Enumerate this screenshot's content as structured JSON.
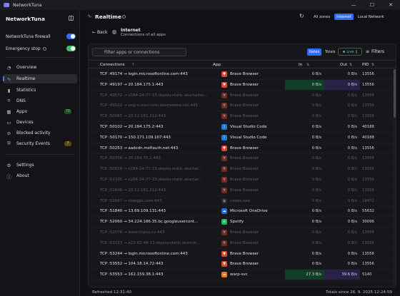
{
  "window": {
    "title": "NetworkTuna",
    "minimize": "—",
    "maximize": "☐",
    "close": "✕"
  },
  "sidebar": {
    "brand": "NetworkTuna",
    "firewall_label": "NetworkTuna firewall",
    "firewall_on": true,
    "emergency_label": "Emergency stop",
    "emergency_on": true,
    "items": [
      {
        "label": "Overview",
        "icon": "◔"
      },
      {
        "label": "Realtime",
        "icon": "∿"
      },
      {
        "label": "Statistics",
        "icon": "▮"
      },
      {
        "label": "DNS",
        "icon": "⌗"
      },
      {
        "label": "Apps",
        "icon": "▦",
        "badge": "78"
      },
      {
        "label": "Devices",
        "icon": "▭"
      },
      {
        "label": "Blocked activity",
        "icon": "⊘"
      },
      {
        "label": "Security Events",
        "icon": "⛨",
        "badge": "7"
      }
    ],
    "bottom_items": [
      {
        "label": "Settings",
        "icon": "⚙"
      },
      {
        "label": "About",
        "icon": "ⓘ"
      }
    ],
    "colors": {
      "toggle_on": "#2f6cff",
      "toggle_green": "#3fc06a",
      "apps_badge_bg": "#1f4a2c",
      "apps_badge_fg": "#4fd07a",
      "security_badge_bg": "#5a4a14",
      "security_badge_fg": "#f2c744"
    }
  },
  "header": {
    "title": "Realtime",
    "zones": [
      "All zones",
      "Internet",
      "Local Network"
    ],
    "selected_zone": "Internet"
  },
  "breadcrumb": {
    "back_label": "Back",
    "title": "Internet",
    "subtitle": "Connections of all apps"
  },
  "toolbar": {
    "search_placeholder": "Filter apps or connections",
    "modes": [
      "Rates",
      "Totals"
    ],
    "selected_mode": "Rates",
    "live_label": "Live",
    "filters_label": "Filters"
  },
  "table": {
    "columns": {
      "connections": "Connections",
      "app": "App",
      "in": "In",
      "out": "Out",
      "pid": "PID"
    },
    "rows": [
      {
        "conn": "TCP :49174 → login.microsoftonline.com:443",
        "app": "Brave Browser",
        "icon": "brave",
        "in": "0 B/s",
        "out": "0 B/s",
        "pid": "13556",
        "dim": false
      },
      {
        "conn": "TCP :49197 → 20.184.175.1:443",
        "app": "Brave Browser",
        "icon": "brave",
        "in": "0 B/s",
        "out": "0 B/s",
        "pid": "13556",
        "dim": false,
        "hi_in": true,
        "hi_out": true
      },
      {
        "conn": "TCP :49572 → s184-24-77-33.deploy.static.akamaitec...",
        "app": "Brave Browser",
        "icon": "brave",
        "in": "0 B/s",
        "out": "0 B/s",
        "pid": "13556",
        "dim": true
      },
      {
        "conn": "TCP :49522 → eng-s-msn-com.akamaized.net:443",
        "app": "Brave Browser",
        "icon": "brave",
        "in": "0 B/s",
        "out": "0 B/s",
        "pid": "13556",
        "dim": true
      },
      {
        "conn": "TCP :50065 → 23.12.161.212:443",
        "app": "Brave Browser",
        "icon": "brave",
        "in": "0 B/s",
        "out": "0 B/s",
        "pid": "13556",
        "dim": true
      },
      {
        "conn": "TCP :50102 → 20.184.175.2:443",
        "app": "Visual Studio Code",
        "icon": "vscode",
        "in": "0 B/s",
        "out": "0 B/s",
        "pid": "40188",
        "dim": false
      },
      {
        "conn": "TCP :50170 → 150.171.109.107:443",
        "app": "Visual Studio Code",
        "icon": "vscode",
        "in": "0 B/s",
        "out": "0 B/s",
        "pid": "40188",
        "dim": false
      },
      {
        "conn": "TCP :50253 → aadcdn.msftauth.net:443",
        "app": "Brave Browser",
        "icon": "brave",
        "in": "0 B/s",
        "out": "0 B/s",
        "pid": "13556",
        "dim": false
      },
      {
        "conn": "TCP :50756 → 35.184.75.1:443",
        "app": "Brave Browser",
        "icon": "brave",
        "in": "0 B/s",
        "out": "0 B/s",
        "pid": "13556",
        "dim": true
      },
      {
        "conn": "TCP :50828 → s184-24-77-33.deploy.static.akamai...",
        "app": "Brave Browser",
        "icon": "brave",
        "in": "0 B/s",
        "out": "0 B/s",
        "pid": "13556",
        "dim": true
      },
      {
        "conn": "TCP :51330 → s184-24-77-33.deploy.static.akamai...",
        "app": "Brave Browser",
        "icon": "brave",
        "in": "0 B/s",
        "out": "0 B/s",
        "pid": "13556",
        "dim": true
      },
      {
        "conn": "TCP :51646 → 23.12.161.212:443",
        "app": "Brave Browser",
        "icon": "brave",
        "in": "0 B/s",
        "out": "0 B/s",
        "pid": "13556",
        "dim": true
      },
      {
        "conn": "TCP :51667 → chatgpt.com:443",
        "app": "codex.exe",
        "icon": "codex",
        "in": "0 B/s",
        "out": "0 B/s",
        "pid": "18472",
        "dim": true
      },
      {
        "conn": "TCP :51840 → 13.69.109.131:443",
        "app": "Microsoft OneDrive",
        "icon": "onedrive",
        "in": "0 B/s",
        "out": "0 B/s",
        "pid": "55632",
        "dim": false
      },
      {
        "conn": "TCP :52060 → 34.224.186.35.bc.googleusercont...",
        "app": "Spotify",
        "icon": "spotify",
        "in": "0 B/s",
        "out": "0 B/s",
        "pid": "30096",
        "dim": false
      },
      {
        "conn": "TCP :52076 → www.linpus.cz:443",
        "app": "Brave Browser",
        "icon": "brave",
        "in": "0 B/s",
        "out": "0 B/s",
        "pid": "13556",
        "dim": true
      },
      {
        "conn": "TCP :52223 → a23-62-46-13.deploy.static.akamai...",
        "app": "Brave Browser",
        "icon": "brave",
        "in": "0 B/s",
        "out": "0 B/s",
        "pid": "13556",
        "dim": true
      },
      {
        "conn": "TCP :53244 → login.microsoftonline.com:443",
        "app": "Brave Browser",
        "icon": "brave",
        "in": "0 B/s",
        "out": "0 B/s",
        "pid": "13556",
        "dim": false
      },
      {
        "conn": "TCP :53552 → 104.18.14.72:443",
        "app": "Brave Browser",
        "icon": "brave",
        "in": "0 B/s",
        "out": "0 B/s",
        "pid": "13556",
        "dim": false
      },
      {
        "conn": "TCP :53553 → 162.159.38.1:443",
        "app": "warp-svc",
        "icon": "warp",
        "in": "27.3 B/s",
        "out": "39.6 B/s",
        "pid": "5140",
        "dim": false,
        "hi_in": true,
        "hi_out": true
      }
    ]
  },
  "footer": {
    "refreshed": "Refreshed 12:31:40",
    "totals_since": "Totals since 26. 9. 2025 12:24:59"
  }
}
